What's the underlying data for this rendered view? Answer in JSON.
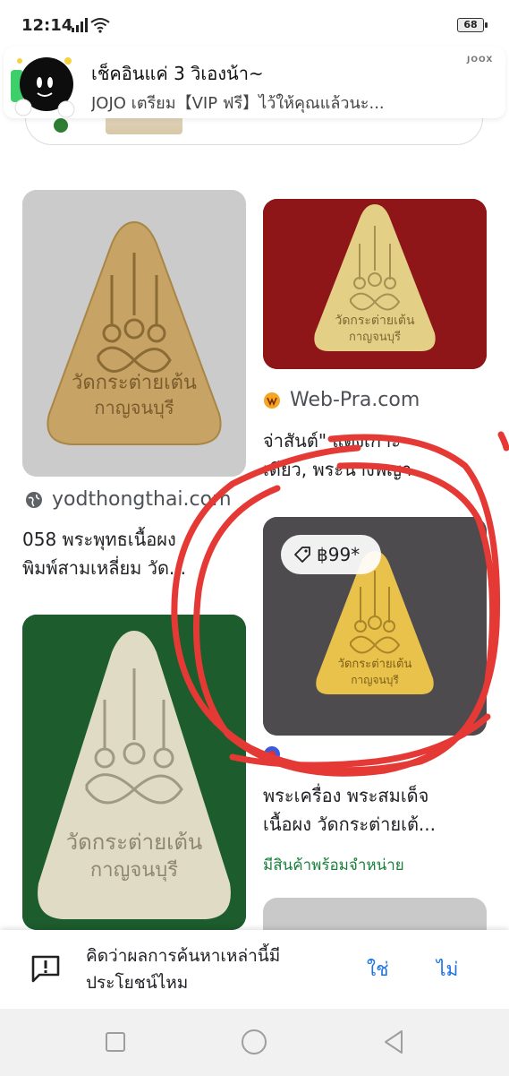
{
  "status_bar": {
    "time": "12:14",
    "battery": "68"
  },
  "notification": {
    "title": "เช็คอินแค่ 3 วิเองน้า~",
    "body": "JOJO เตรียม【VIP ฟรี】ไว้ให้คุณแล้วนะ...",
    "app_name": "JOOX"
  },
  "results": [
    {
      "source": "yodthongthai.com",
      "title_lines": [
        "058 พระพุทธเนื้อผง",
        "พิมพ์สามเหลี่ยม วัด..."
      ]
    },
    {
      "source": "Web-Pra.com",
      "title_lines": [
        "จ่าสันต์\" แดงเกาะ",
        "เดียว, พระนางพญา"
      ]
    },
    {
      "source": "",
      "price": "฿99*",
      "title_lines": [
        "พระเครื่อง พระสมเด็จ",
        "เนื้อผง วัดกระต่ายเต้..."
      ],
      "stock_label": "มีสินค้าพร้อมจำหน่าย"
    }
  ],
  "amulet_text": {
    "line1": "วัดกระต่ายเต้น",
    "line2": "กาญจนบุรี"
  },
  "feedback": {
    "question": "คิดว่าผลการค้นหาเหล่านี้มีประโยชน์ไหม",
    "yes_label": "ใช่",
    "no_label": "ไม่"
  },
  "colors": {
    "link_blue": "#1a73e8",
    "stock_green": "#188038",
    "annotation_red": "#e53935"
  },
  "icons": [
    "signal-icon",
    "wifi-icon",
    "globe-icon",
    "tag-icon",
    "feedback-icon",
    "recents-icon",
    "home-icon",
    "back-icon"
  ]
}
